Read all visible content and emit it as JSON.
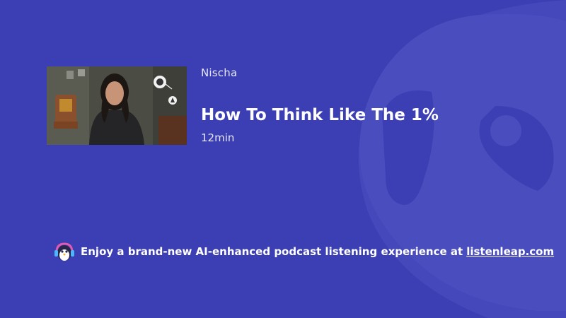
{
  "episode": {
    "author": "Nischa",
    "title": "How To Think Like The 1%",
    "duration": "12min",
    "thumbnail_icon": "video-thumbnail-woman-speaking"
  },
  "promo": {
    "icon": "penguin-headphones-icon",
    "text": "Enjoy a brand-new AI-enhanced podcast listening experience at",
    "link_text": "listenleap.com"
  },
  "colors": {
    "background": "#3c3fb4",
    "watermark": "#4c4fbd",
    "text": "#ffffff"
  }
}
